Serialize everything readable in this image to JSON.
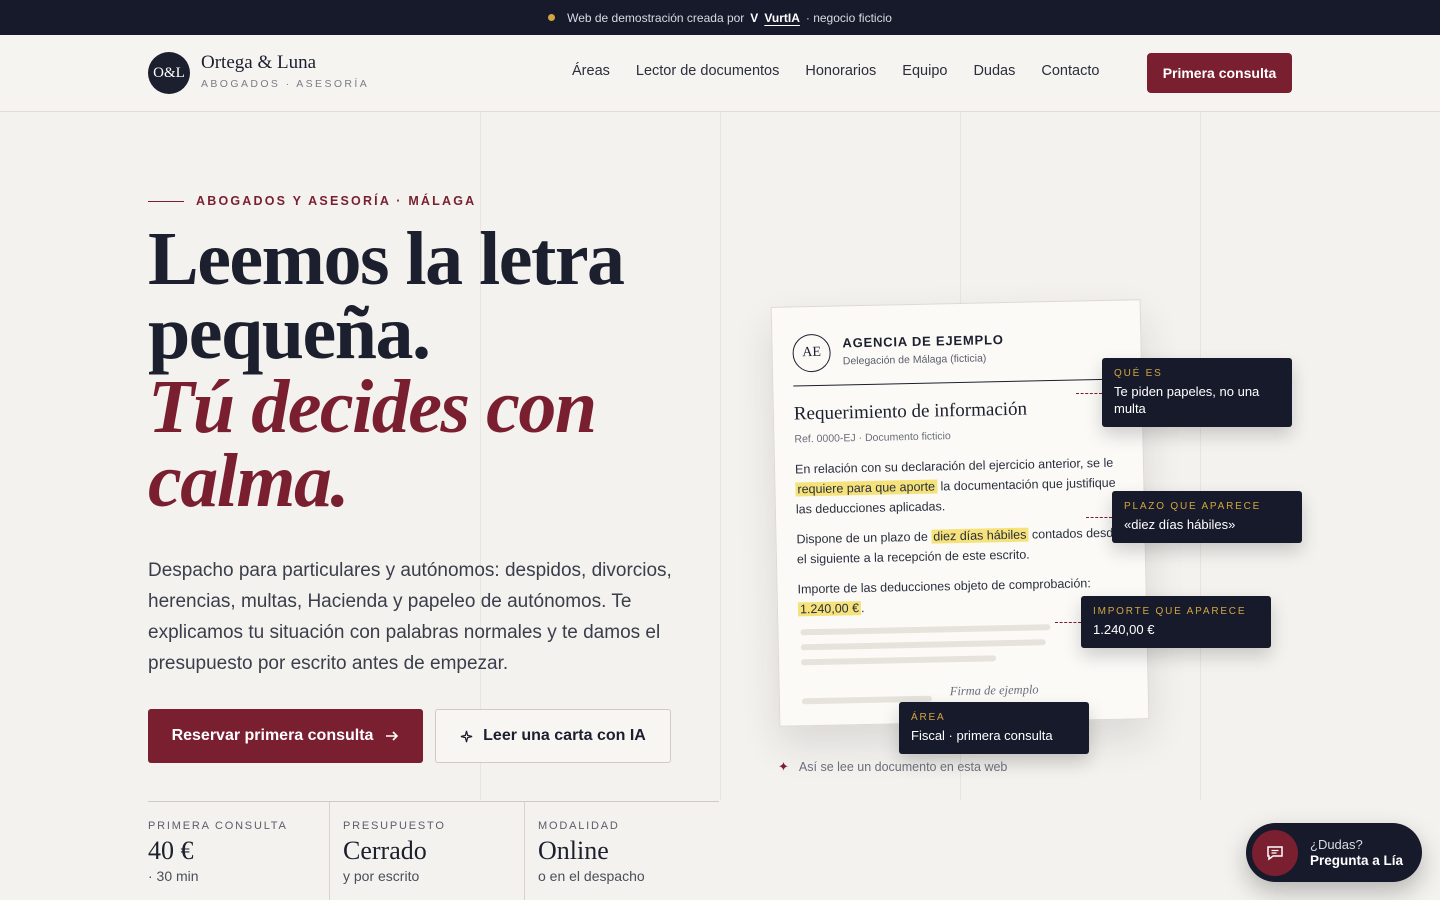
{
  "banner": {
    "prefix": "Web de demostración creada por",
    "brand": "VurtIA",
    "suffix": "· negocio ficticio"
  },
  "nav": {
    "logo_mark": "O&L",
    "logo_name": "Ortega & Luna",
    "logo_sub": "ABOGADOS · ASESORÍA",
    "links": [
      "Áreas",
      "Lector de documentos",
      "Honorarios",
      "Equipo",
      "Dudas",
      "Contacto"
    ],
    "cta": "Primera consulta"
  },
  "hero": {
    "eyebrow": "ABOGADOS Y ASESORÍA · MÁLAGA",
    "title_line1": "Leemos la letra pequeña.",
    "title_line2": "Tú decides con calma.",
    "lead": "Despacho para particulares y autónomos: despidos, divorcios, herencias, multas, Hacienda y papeleo de autónomos. Te explicamos tu situación con palabras normales y te damos el presupuesto por escrito antes de empezar.",
    "btn_primary": "Reservar primera consulta",
    "btn_secondary": "Leer una carta con IA"
  },
  "stats": [
    {
      "label": "PRIMERA CONSULTA",
      "value": "40 €",
      "note": "· 30 min"
    },
    {
      "label": "PRESUPUESTO",
      "value": "Cerrado",
      "note": "y por escrito"
    },
    {
      "label": "MODALIDAD",
      "value": "Online",
      "note": "o en el despacho"
    }
  ],
  "document": {
    "seal": "AE",
    "org": "AGENCIA DE EJEMPLO",
    "org_sub": "Delegación de Málaga (ficticia)",
    "title": "Requerimiento de información",
    "ref": "Ref. 0000-EJ · Documento ficticio",
    "p1_a": "En relación con su declaración del ejercicio anterior, se le",
    "p1_hl": "requiere para que aporte",
    "p1_b": "la documentación que justifique las deducciones aplicadas.",
    "p2_a": "Dispone de un plazo de",
    "p2_hl": "diez días hábiles",
    "p2_b": "contados desde el siguiente a la recepción de este escrito.",
    "p3_a": "Importe de las deducciones objeto de comprobación:",
    "p3_hl": "1.240,00 €",
    "p3_b": ".",
    "signature": "Firma de ejemplo"
  },
  "tips": [
    {
      "label": "QUÉ ES",
      "text": "Te piden papeles, no una multa"
    },
    {
      "label": "PLAZO QUE APARECE",
      "text": "«diez días hábiles»"
    },
    {
      "label": "IMPORTE QUE APARECE",
      "text": "1.240,00 €"
    },
    {
      "label": "ÁREA",
      "text": "Fiscal · primera consulta"
    }
  ],
  "caption": "Así se lee un documento en esta web",
  "chat": {
    "line1": "¿Dudas?",
    "line2": "Pregunta a Lía"
  },
  "colors": {
    "accent": "#7a1f30",
    "navy": "#161a2b",
    "gold": "#d3a53f",
    "highlight": "#f5e27a"
  }
}
